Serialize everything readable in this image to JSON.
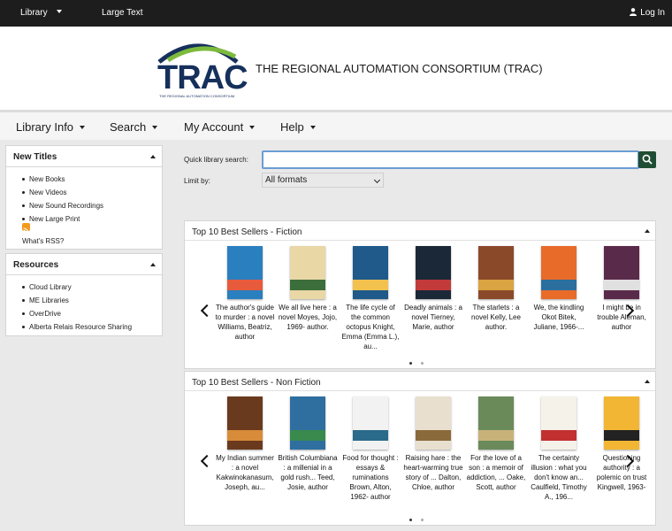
{
  "topbar": {
    "library": "Library",
    "large_text": "Large Text",
    "login": "Log In"
  },
  "header": {
    "logo_text": "TRAC",
    "logo_tagline": "THE REGIONAL AUTOMATION CONSORTIUM",
    "site_title": "THE REGIONAL AUTOMATION CONSORTIUM (TRAC)"
  },
  "nav": {
    "library_info": "Library Info",
    "search": "Search",
    "my_account": "My Account",
    "help": "Help"
  },
  "sidebar": {
    "new_titles": {
      "title": "New Titles",
      "items": [
        "New Books",
        "New Videos",
        "New Sound Recordings",
        "New Large Print"
      ],
      "rss_label": "What's RSS?"
    },
    "resources": {
      "title": "Resources",
      "items": [
        "Cloud Library",
        "ME Libraries",
        "OverDrive",
        "Alberta Relais Resource Sharing"
      ]
    }
  },
  "search": {
    "label": "Quick library search:",
    "value": "",
    "limit_label": "Limit by:",
    "limit_value": "All formats"
  },
  "carousels": [
    {
      "title": "Top 10 Best Sellers - Fiction",
      "books": [
        {
          "caption": "The author's guide to murder : a novel Williams, Beatriz, author",
          "colors": [
            "#2a7fbf",
            "#e85a3c"
          ]
        },
        {
          "caption": "We all live here : a novel Moyes, Jojo, 1969- author.",
          "colors": [
            "#e9d7a6",
            "#3b6e3a"
          ]
        },
        {
          "caption": "The life cycle of the common octopus Knight, Emma (Emma L.), au...",
          "colors": [
            "#1f5a8a",
            "#f2c14e"
          ]
        },
        {
          "caption": "Deadly animals : a novel Tierney, Marie, author",
          "colors": [
            "#1b2838",
            "#c33a3a"
          ]
        },
        {
          "caption": "The starlets : a novel Kelly, Lee author.",
          "colors": [
            "#8a4a2a",
            "#d9a441"
          ]
        },
        {
          "caption": "We, the kindling Okot Bitek, Juliane, 1966-...",
          "colors": [
            "#e86b2a",
            "#2a6f9e"
          ]
        },
        {
          "caption": "I might be in trouble Aleman, author",
          "colors": [
            "#5a2a4a",
            "#e0e0e0"
          ]
        }
      ]
    },
    {
      "title": "Top 10 Best Sellers - Non Fiction",
      "books": [
        {
          "caption": "My Indian summer : a novel Kakwinokanasum, Joseph, au...",
          "colors": [
            "#6a3a1e",
            "#d88c3a"
          ]
        },
        {
          "caption": "British Columbiana : a millenial in a gold rush... Teed, Josie, author",
          "colors": [
            "#2e6fa0",
            "#3a8a4e"
          ]
        },
        {
          "caption": "Food for thought : essays & ruminations Brown, Alton, 1962- author",
          "colors": [
            "#f2f2f2",
            "#2a6a8a"
          ]
        },
        {
          "caption": "Raising hare : the heart-warming true story of ... Dalton, Chloe, author",
          "colors": [
            "#e8dfcf",
            "#8a6a3a"
          ]
        },
        {
          "caption": "For the love of a son : a memoir of addiction, ... Oake, Scott, author",
          "colors": [
            "#6a8a5a",
            "#c9b27a"
          ]
        },
        {
          "caption": "The certainty illusion : what you don't know an... Caulfield, Timothy A., 196...",
          "colors": [
            "#f5f2ea",
            "#c23030"
          ]
        },
        {
          "caption": "Questioning authority : a polemic on trust Kingwell, 1963-",
          "colors": [
            "#f2b634",
            "#222222"
          ]
        }
      ]
    }
  ]
}
